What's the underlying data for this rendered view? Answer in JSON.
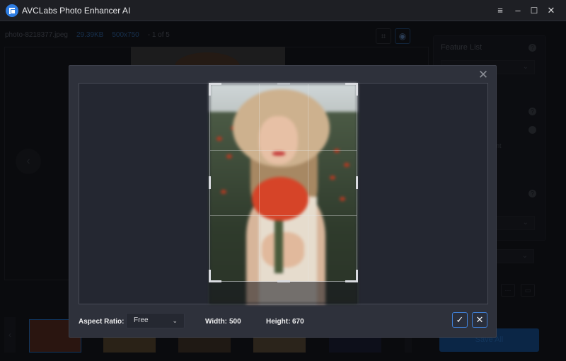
{
  "app": {
    "title": "AVCLabs Photo Enhancer AI",
    "window_controls": {
      "menu": "≡",
      "minimize": "–",
      "maximize": "☐",
      "close": "✕"
    }
  },
  "file_info": {
    "filename": "photo-8218377.jpeg",
    "size": "29.39KB",
    "dimensions": "500x750",
    "position": "- 1 of 5"
  },
  "toolbar": {
    "crop_icon": "⌗",
    "preview_icon": "◉"
  },
  "preview": {
    "prev_arrow": "‹"
  },
  "right_panel": {
    "feature_list_title": "Feature List",
    "help": "?",
    "partial_text": "nt",
    "more_button": "···",
    "folder_button": "▭",
    "dropdown_chevron": "⌄"
  },
  "filmstrip": {
    "left_arrow": "‹",
    "thumbnails": [
      {
        "label": "thumbnail-1",
        "active": true
      },
      {
        "label": "thumbnail-2",
        "active": false
      },
      {
        "label": "thumbnail-3",
        "active": false
      },
      {
        "label": "thumbnail-4",
        "active": false
      },
      {
        "label": "thumbnail-5",
        "active": false
      }
    ]
  },
  "save_all_label": "Save All",
  "crop_dialog": {
    "close": "✕",
    "aspect_ratio_label": "Aspect Ratio:",
    "aspect_ratio_value": "Free",
    "chevron": "⌄",
    "width_label": "Width:",
    "width_value": "500",
    "height_label": "Height:",
    "height_value": "670",
    "confirm": "✓",
    "cancel": "✕",
    "accent_color": "#3f7ed4"
  }
}
